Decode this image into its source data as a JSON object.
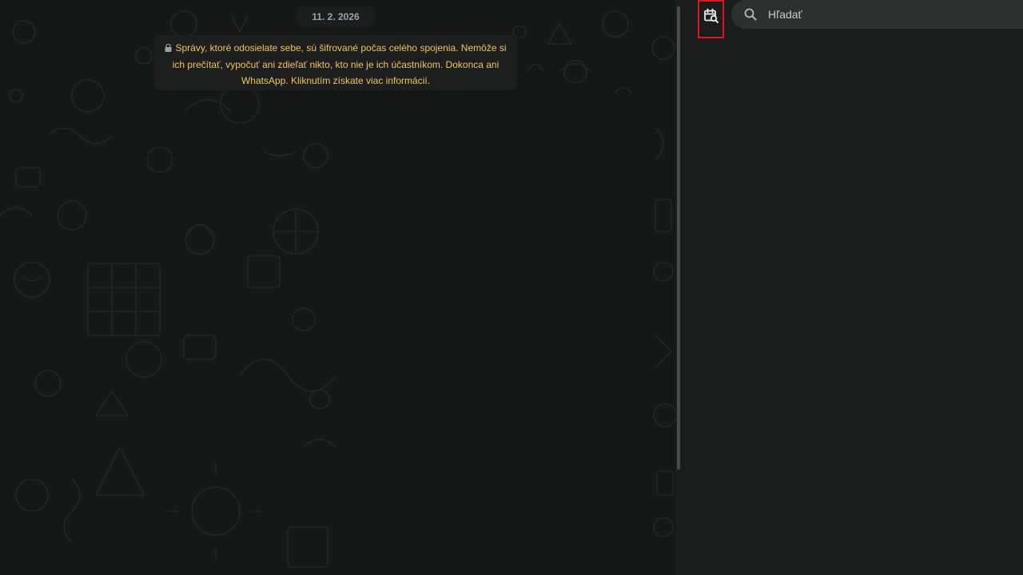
{
  "chat": {
    "date_chip": "11. 2. 2026",
    "encryption_notice": "Správy, ktoré odosielate sebe, sú šifrované počas celého spojenia. Nemôže si ich prečítať, vypočuť ani zdieľať nikto, kto nie je ich účastníkom. Dokonca ani WhatsApp. Kliknutím získate viac informácií."
  },
  "search_panel": {
    "search_placeholder": "Hľadať",
    "icons": {
      "calendar_search": "calendar-search-icon",
      "search": "search-icon",
      "lock": "lock-icon"
    }
  },
  "colors": {
    "background": "#161717",
    "notice_text": "#f2c55c",
    "highlight_border": "#e0161e",
    "search_box": "#2e2f2f"
  }
}
